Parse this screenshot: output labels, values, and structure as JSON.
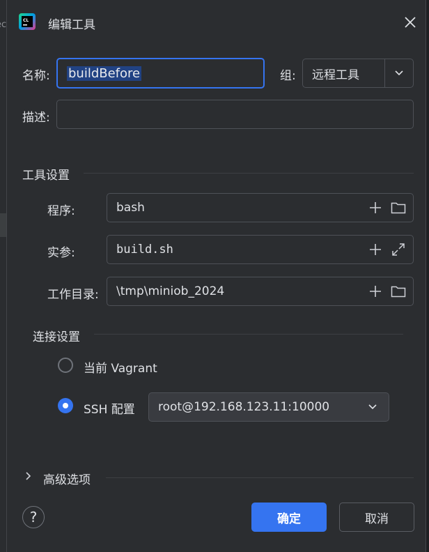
{
  "background": {
    "left_text": "ec"
  },
  "dialog": {
    "title": "编辑工具",
    "app_icon": "clion-icon"
  },
  "form": {
    "name_label": "名称:",
    "name_value": "buildBefore",
    "group_label": "组:",
    "group_value": "远程工具",
    "desc_label": "描述:",
    "desc_value": ""
  },
  "tool_settings": {
    "title": "工具设置",
    "program_label": "程序:",
    "program_value": "bash",
    "args_label": "实参:",
    "args_value": "build.sh",
    "workdir_label": "工作目录:",
    "workdir_value": "\\tmp\\miniob_2024"
  },
  "connection": {
    "title": "连接设置",
    "option_local": "当前 Vagrant",
    "option_ssh": "SSH 配置",
    "selected": "ssh",
    "ssh_value": "root@192.168.123.11:10000"
  },
  "advanced": {
    "label": "高级选项"
  },
  "buttons": {
    "ok": "确定",
    "cancel": "取消",
    "help": "?"
  },
  "colors": {
    "accent": "#3574f0",
    "background": "#2b2d30",
    "text": "#dfe1e5"
  }
}
